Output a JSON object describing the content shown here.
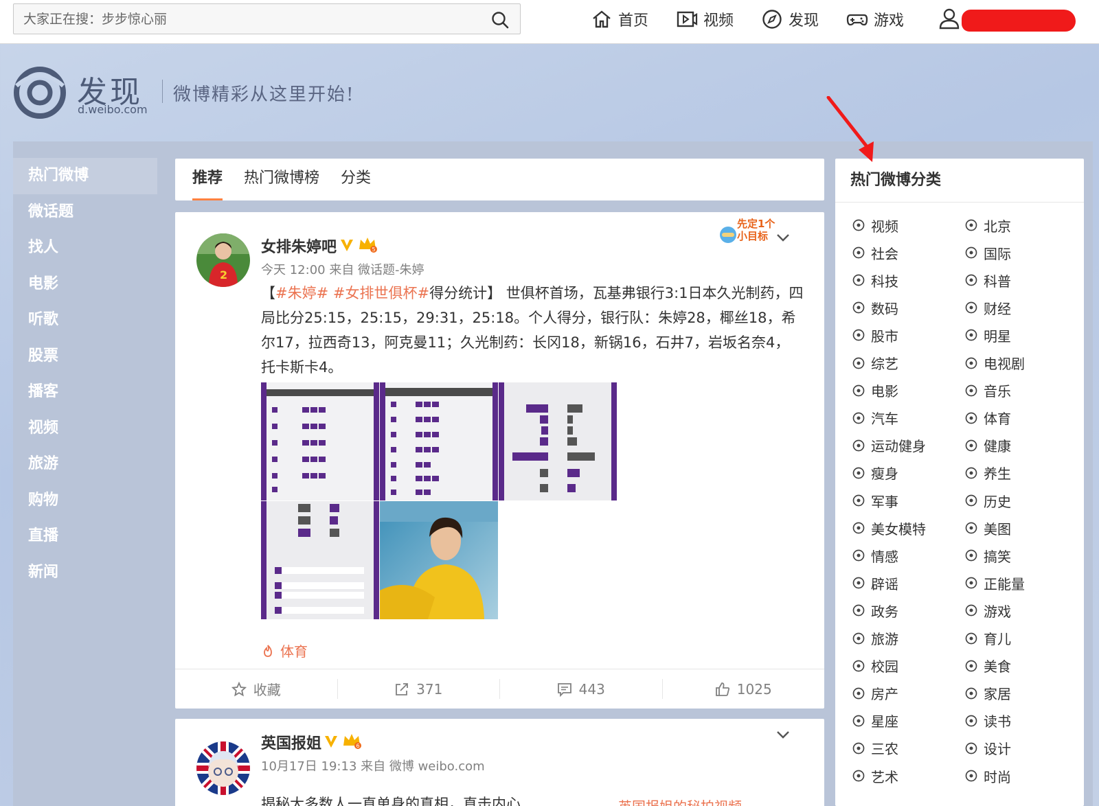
{
  "search": {
    "placeholder": "大家正在搜：步步惊心丽"
  },
  "topnav": [
    {
      "label": "首页",
      "icon": "home-icon"
    },
    {
      "label": "视频",
      "icon": "video-icon"
    },
    {
      "label": "发现",
      "icon": "compass-icon"
    },
    {
      "label": "游戏",
      "icon": "gamepad-icon"
    }
  ],
  "banner": {
    "title": "发现",
    "url": "d.weibo.com",
    "slogan": "微博精彩从这里开始!"
  },
  "left_nav": [
    "热门微博",
    "微话题",
    "找人",
    "电影",
    "听歌",
    "股票",
    "播客",
    "视频",
    "旅游",
    "购物",
    "直播",
    "新闻"
  ],
  "tabs": [
    "推荐",
    "热门微博榜",
    "分类"
  ],
  "post1": {
    "username": "女排朱婷吧",
    "meta": "今天 12:00 来自 微话题-朱婷",
    "text_prefix": "【",
    "tag1": "#朱婷#",
    "tag2": " #女排世俱杯#",
    "text_body": "得分统计】 世俱杯首场，瓦基弗银行3:1日本久光制药，四局比分25:15，25:15，29:31，25:18。个人得分，银行队：朱婷28，椰丝18，希尔17，拉西奇13，阿克曼11；久光制药：长冈18，新锅16，石井7，岩坂名奈4，托卡斯卡4。",
    "sticker": "先定1个小目标",
    "topic": "体育",
    "actions": {
      "fav": "收藏",
      "repost": "371",
      "comment": "443",
      "like": "1025"
    }
  },
  "post2": {
    "username": "英国报姐",
    "meta": "10月17日 19:13 来自 微博 weibo.com",
    "text": "揭秘大多数人一直单身的真相，直击内心",
    "side": "英国报姐的秘拍视频"
  },
  "right": {
    "title": "热门微博分类",
    "categories": [
      [
        "视频",
        "北京"
      ],
      [
        "社会",
        "国际"
      ],
      [
        "科技",
        "科普"
      ],
      [
        "数码",
        "财经"
      ],
      [
        "股市",
        "明星"
      ],
      [
        "综艺",
        "电视剧"
      ],
      [
        "电影",
        "音乐"
      ],
      [
        "汽车",
        "体育"
      ],
      [
        "运动健身",
        "健康"
      ],
      [
        "瘦身",
        "养生"
      ],
      [
        "军事",
        "历史"
      ],
      [
        "美女模特",
        "美图"
      ],
      [
        "情感",
        "搞笑"
      ],
      [
        "辟谣",
        "正能量"
      ],
      [
        "政务",
        "游戏"
      ],
      [
        "旅游",
        "育儿"
      ],
      [
        "校园",
        "美食"
      ],
      [
        "房产",
        "家居"
      ],
      [
        "星座",
        "读书"
      ],
      [
        "三农",
        "设计"
      ],
      [
        "艺术",
        "时尚"
      ]
    ]
  },
  "colors": {
    "accent": "#ff8140",
    "tag": "#eb7350",
    "redact": "#f01a1a",
    "arrow": "#f01a1a"
  }
}
